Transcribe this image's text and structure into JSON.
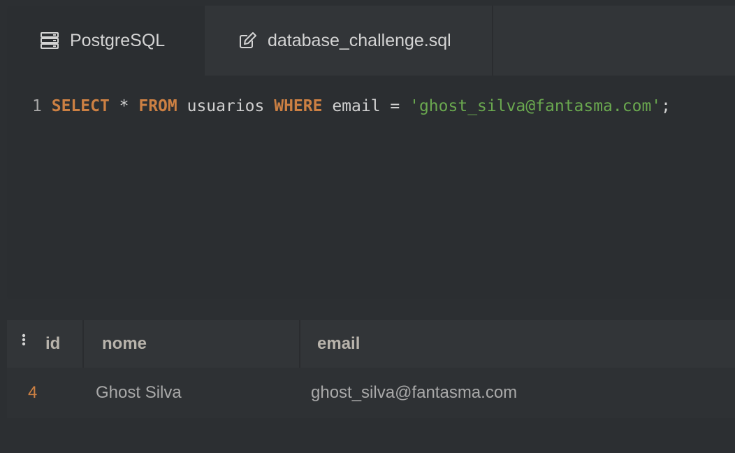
{
  "tabs": [
    {
      "label": "PostgreSQL",
      "icon": "server-icon"
    },
    {
      "label": "database_challenge.sql",
      "icon": "edit-icon"
    }
  ],
  "editor": {
    "line_number": "1",
    "tokens": [
      {
        "text": "SELECT",
        "type": "keyword"
      },
      {
        "text": " * ",
        "type": "plain"
      },
      {
        "text": "FROM",
        "type": "keyword"
      },
      {
        "text": " usuarios ",
        "type": "plain"
      },
      {
        "text": "WHERE",
        "type": "keyword"
      },
      {
        "text": " email = ",
        "type": "plain"
      },
      {
        "text": "'ghost_silva@fantasma.com'",
        "type": "string"
      },
      {
        "text": ";",
        "type": "plain"
      }
    ]
  },
  "results": {
    "columns": [
      "id",
      "nome",
      "email"
    ],
    "rows": [
      {
        "id": "4",
        "nome": "Ghost Silva",
        "email": "ghost_silva@fantasma.com"
      }
    ]
  },
  "colors": {
    "keyword": "#cc8043",
    "string": "#6aa84f",
    "background": "#2c2f32"
  }
}
